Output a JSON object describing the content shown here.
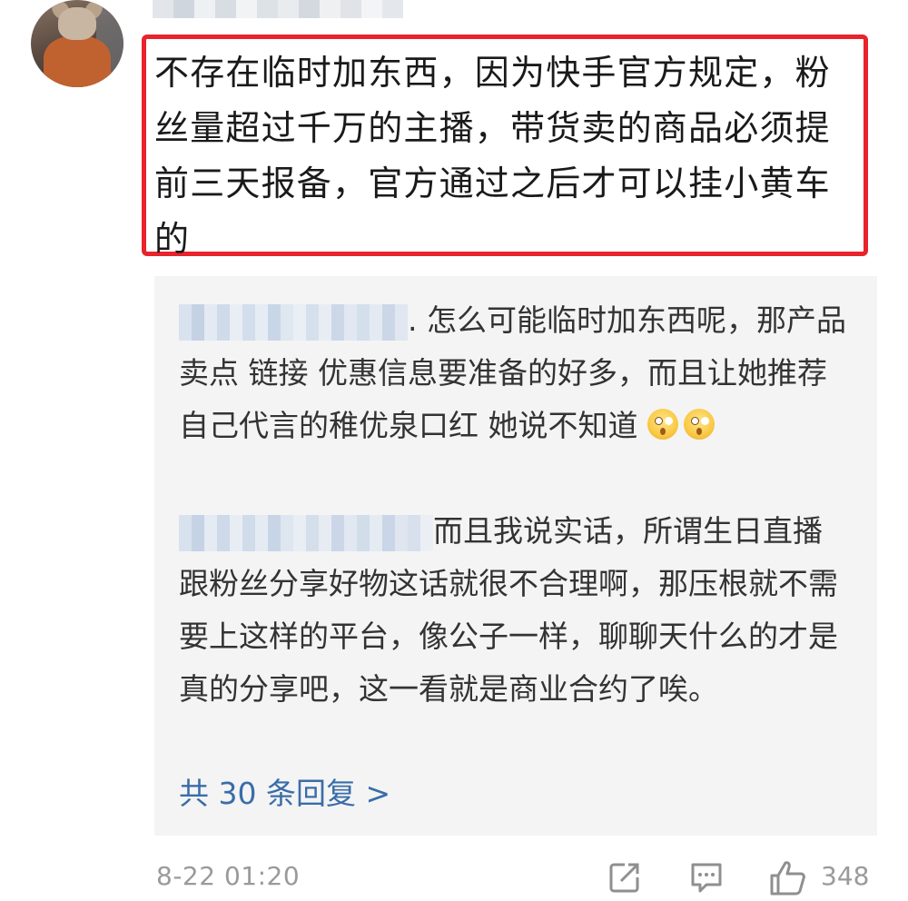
{
  "comment": {
    "text": "不存在临时加东西，因为快手官方规定，粉丝量超过千万的主播，带货卖的商品必须提前三天报备，官方通过之后才可以挂小黄车的"
  },
  "replies": [
    {
      "text": ". 怎么可能临时加东西呢，那产品卖点 链接 优惠信息要准备的好多，而且让她推荐自己代言的稚优泉口红 她说不知道"
    },
    {
      "text": "而且我说实话，所谓生日直播跟粉丝分享好物这话就很不合理啊，那压根就不需要上这样的平台，像公子一样，聊聊天什么的才是真的分享吧，这一看就是商业合约了唉。"
    }
  ],
  "more_replies_label": "共 30 条回复 >",
  "meta": {
    "timestamp": "8-22 01:20",
    "like_count": "348"
  },
  "icons": {
    "forward": "forward-icon",
    "comment": "comment-icon",
    "like": "like-icon",
    "emoji": "astonished-face-icon"
  },
  "colors": {
    "highlight_border": "#e8232b",
    "link": "#3a6da8",
    "meta_text": "#9a9a9a",
    "reply_background": "#f4f4f4"
  }
}
